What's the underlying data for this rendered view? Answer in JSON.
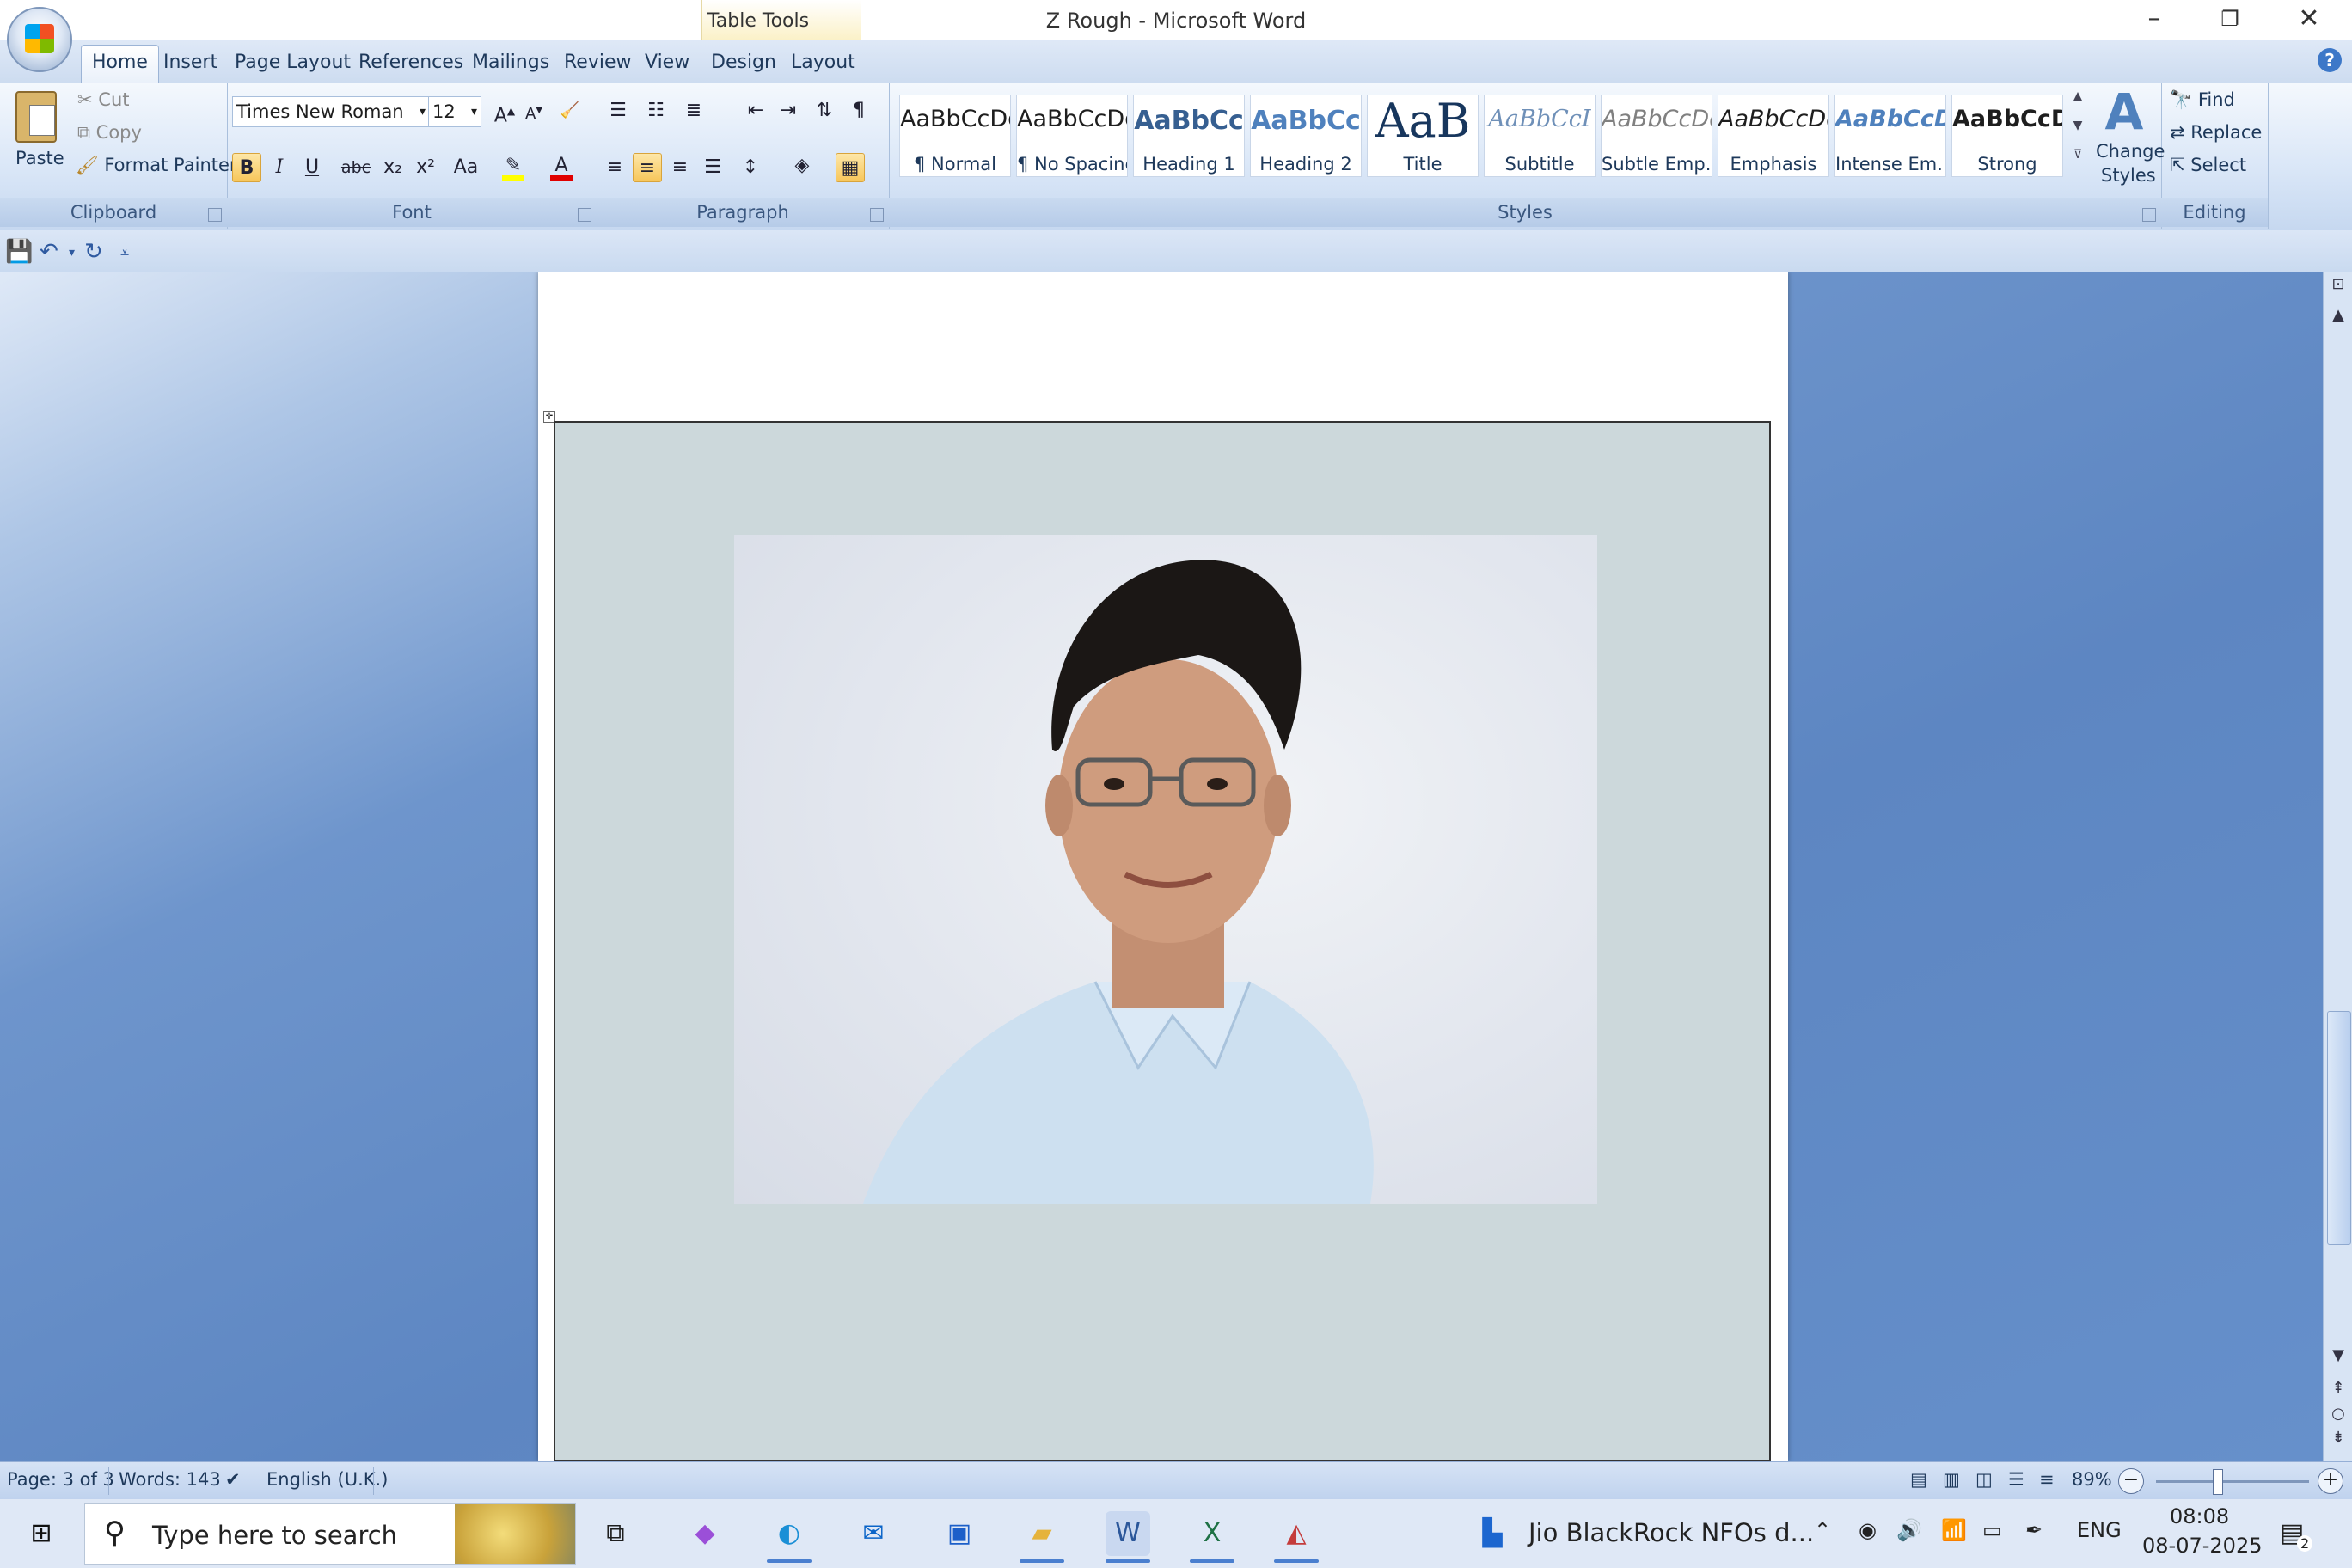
{
  "window": {
    "title": "Z Rough - Microsoft Word",
    "contextual_tab_group": "Table Tools"
  },
  "tabs": [
    "Home",
    "Insert",
    "Page Layout",
    "References",
    "Mailings",
    "Review",
    "View",
    "Design",
    "Layout"
  ],
  "clipboard": {
    "paste": "Paste",
    "cut": "Cut",
    "copy": "Copy",
    "format_painter": "Format Painter",
    "label": "Clipboard"
  },
  "font": {
    "family": "Times New Roman",
    "size": "12",
    "label": "Font",
    "grow": "A",
    "shrink": "A",
    "bold": "B",
    "italic": "I",
    "underline": "U",
    "strike": "abc",
    "subscript": "x₂",
    "superscript": "x²",
    "change_case": "Aa",
    "color_letter": "A"
  },
  "paragraph": {
    "label": "Paragraph",
    "pilcrow": "¶"
  },
  "styles": {
    "label": "Styles",
    "items": [
      {
        "sample": "AaBbCcDd",
        "name": "¶ Normal"
      },
      {
        "sample": "AaBbCcDd",
        "name": "¶ No Spacing"
      },
      {
        "sample": "AaBbCc",
        "name": "Heading 1"
      },
      {
        "sample": "AaBbCc",
        "name": "Heading 2"
      },
      {
        "sample": "AaB",
        "name": "Title"
      },
      {
        "sample": "AaBbCcI",
        "name": "Subtitle"
      },
      {
        "sample": "AaBbCcDd",
        "name": "Subtle Emp..."
      },
      {
        "sample": "AaBbCcDd",
        "name": "Emphasis"
      },
      {
        "sample": "AaBbCcDd",
        "name": "Intense Em..."
      },
      {
        "sample": "AaBbCcDd",
        "name": "Strong"
      }
    ],
    "change_styles_line1": "Change",
    "change_styles_line2": "Styles"
  },
  "editing": {
    "find": "Find",
    "replace": "Replace",
    "select": "Select",
    "label": "Editing"
  },
  "status": {
    "page": "Page: 3 of 3",
    "words": "Words: 143",
    "language": "English (U.K.)",
    "zoom": "89%"
  },
  "taskbar": {
    "search_placeholder": "Type here to search",
    "running_app": "Jio BlackRock NFOs d...",
    "lang": "ENG",
    "time": "08:08",
    "date": "08-07-2025",
    "notifications": "2"
  },
  "colors": {
    "accent": "#2b579a",
    "ribbon_bg": "#d9e6f7",
    "cell_shading": "#ccd8db",
    "workspace": "#5d86c2",
    "font_color_bar": "#e00000",
    "highlight_bar": "#ffff00"
  }
}
